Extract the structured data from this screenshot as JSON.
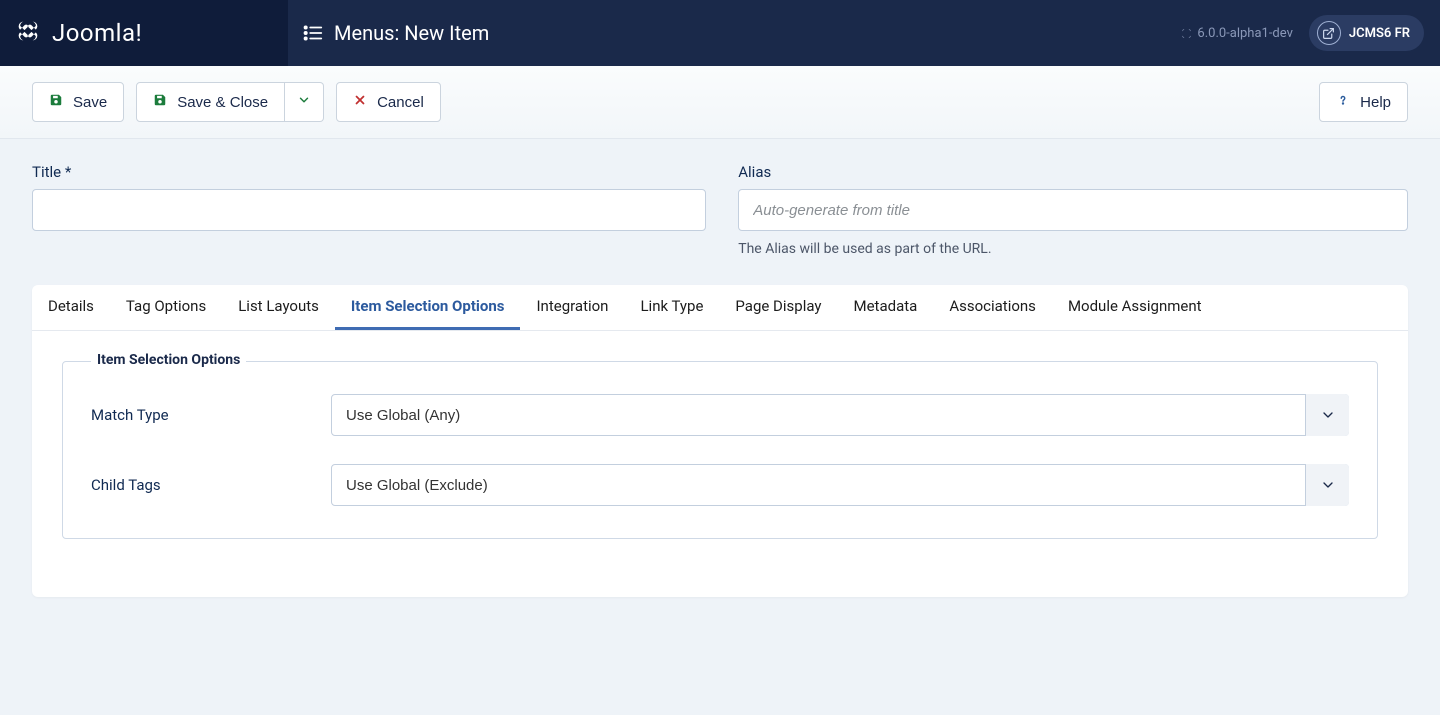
{
  "header": {
    "logo_text": "Joomla!",
    "page_title": "Menus: New Item",
    "version": "6.0.0-alpha1-dev",
    "site_badge": "JCMS6 FR"
  },
  "toolbar": {
    "save": "Save",
    "save_close": "Save & Close",
    "cancel": "Cancel",
    "help": "Help"
  },
  "form": {
    "title_label": "Title *",
    "alias_label": "Alias",
    "alias_placeholder": "Auto-generate from title",
    "alias_help": "The Alias will be used as part of the URL."
  },
  "tabs": [
    {
      "label": "Details",
      "active": false
    },
    {
      "label": "Tag Options",
      "active": false
    },
    {
      "label": "List Layouts",
      "active": false
    },
    {
      "label": "Item Selection Options",
      "active": true
    },
    {
      "label": "Integration",
      "active": false
    },
    {
      "label": "Link Type",
      "active": false
    },
    {
      "label": "Page Display",
      "active": false
    },
    {
      "label": "Metadata",
      "active": false
    },
    {
      "label": "Associations",
      "active": false
    },
    {
      "label": "Module Assignment",
      "active": false
    }
  ],
  "fieldset": {
    "legend": "Item Selection Options",
    "match_type_label": "Match Type",
    "match_type_value": "Use Global (Any)",
    "child_tags_label": "Child Tags",
    "child_tags_value": "Use Global (Exclude)"
  }
}
